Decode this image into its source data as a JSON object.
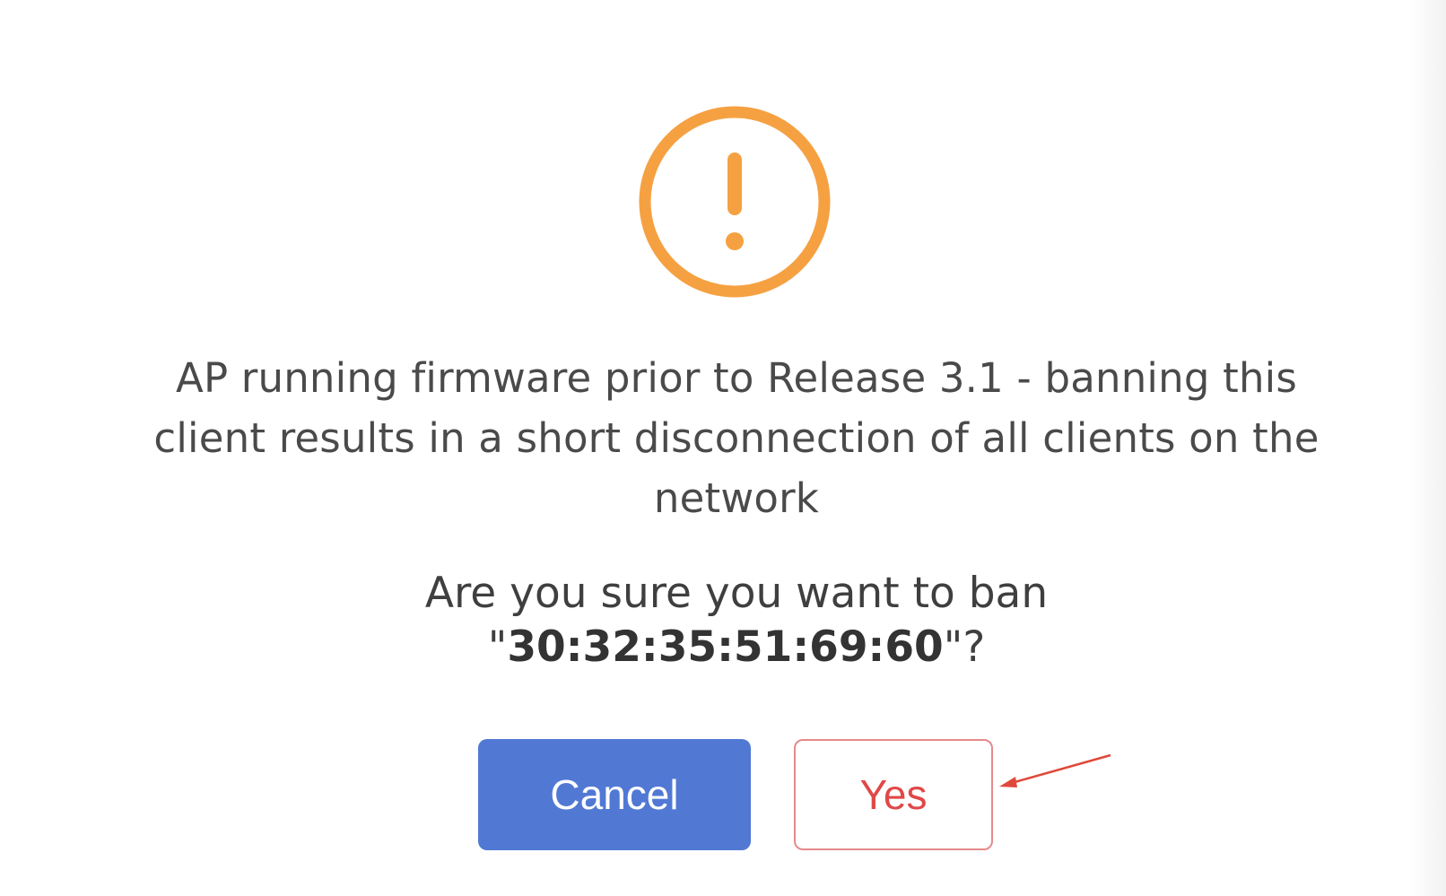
{
  "dialog": {
    "icon": "exclamation-circle-icon",
    "message": "AP running firmware prior to Release 3.1 - banning this client results in a short disconnection of all clients on the network",
    "question_prefix": "Are you sure you want to ban",
    "question_quote_open": "\"",
    "mac_address": "30:32:35:51:69:60",
    "question_suffix": "\"?",
    "cancel_label": "Cancel",
    "yes_label": "Yes"
  },
  "annotation": {
    "icon": "red-arrow-pointer"
  },
  "colors": {
    "warning": "#f5a142",
    "cancel_bg": "#5179d4",
    "yes_text": "#e04848",
    "yes_border": "#e58a8a",
    "annotation_arrow": "#e0483a"
  }
}
